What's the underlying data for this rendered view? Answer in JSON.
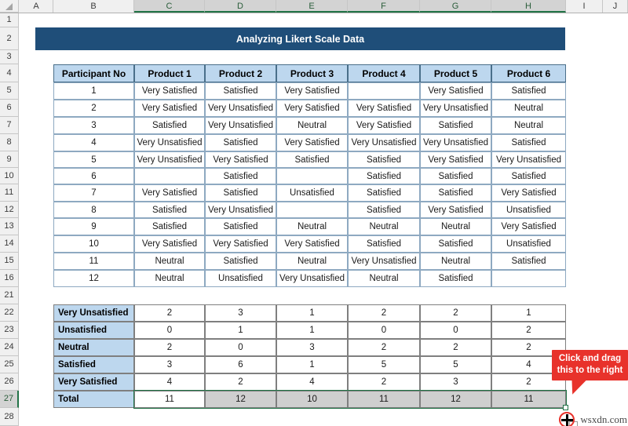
{
  "spreadsheet": {
    "column_headers": [
      "A",
      "B",
      "C",
      "D",
      "E",
      "F",
      "G",
      "H",
      "I",
      "J"
    ],
    "selected_columns": [
      "C",
      "D",
      "E",
      "F",
      "G",
      "H"
    ],
    "row_headers": [
      "1",
      "2",
      "3",
      "4",
      "5",
      "6",
      "7",
      "8",
      "9",
      "10",
      "11",
      "12",
      "13",
      "14",
      "15",
      "16",
      "21",
      "22",
      "23",
      "24",
      "25",
      "26",
      "27",
      "28"
    ],
    "selected_row": "27"
  },
  "title": {
    "text": "Analyzing Likert Scale Data",
    "background": "#1f4e79",
    "color": "#ffffff"
  },
  "main_table": {
    "headers": [
      "Participant No",
      "Product 1",
      "Product 2",
      "Product 3",
      "Product 4",
      "Product 5",
      "Product 6"
    ],
    "header_background": "#bdd7ee",
    "rows": [
      [
        "1",
        "Very Satisfied",
        "Satisfied",
        "Very Satisfied",
        "",
        "Very Satisfied",
        "Satisfied"
      ],
      [
        "2",
        "Very Satisfied",
        "Very Unsatisfied",
        "Very Satisfied",
        "Very Satisfied",
        "Very Unsatisfied",
        "Neutral"
      ],
      [
        "3",
        "Satisfied",
        "Very Unsatisfied",
        "Neutral",
        "Very Satisfied",
        "Satisfied",
        "Neutral"
      ],
      [
        "4",
        "Very Unsatisfied",
        "Satisfied",
        "Very Satisfied",
        "Very Unsatisfied",
        "Very Unsatisfied",
        "Satisfied"
      ],
      [
        "5",
        "Very Unsatisfied",
        "Very Satisfied",
        "Satisfied",
        "Satisfied",
        "Very Satisfied",
        "Very Unsatisfied"
      ],
      [
        "6",
        "",
        "Satisfied",
        "",
        "Satisfied",
        "Satisfied",
        "Satisfied"
      ],
      [
        "7",
        "Very Satisfied",
        "Satisfied",
        "Unsatisfied",
        "Satisfied",
        "Satisfied",
        "Very Satisfied"
      ],
      [
        "8",
        "Satisfied",
        "Very Unsatisfied",
        "",
        "Satisfied",
        "Very Satisfied",
        "Unsatisfied"
      ],
      [
        "9",
        "Satisfied",
        "Satisfied",
        "Neutral",
        "Neutral",
        "Neutral",
        "Very Satisfied"
      ],
      [
        "10",
        "Very Satisfied",
        "Very Satisfied",
        "Very Satisfied",
        "Satisfied",
        "Satisfied",
        "Unsatisfied"
      ],
      [
        "11",
        "Neutral",
        "Satisfied",
        "Neutral",
        "Very Unsatisfied",
        "Neutral",
        "Satisfied"
      ],
      [
        "12",
        "Neutral",
        "Unsatisfied",
        "Very Unsatisfied",
        "Neutral",
        "Satisfied",
        ""
      ]
    ]
  },
  "summary_table": {
    "labels": [
      "Very Unsatisfied",
      "Unsatisfied",
      "Neutral",
      "Satisfied",
      "Very Satisfied",
      "Total"
    ],
    "rows": [
      [
        "2",
        "3",
        "1",
        "2",
        "2",
        "1"
      ],
      [
        "0",
        "1",
        "1",
        "0",
        "0",
        "2"
      ],
      [
        "2",
        "0",
        "3",
        "2",
        "2",
        "2"
      ],
      [
        "3",
        "6",
        "1",
        "5",
        "5",
        "4"
      ],
      [
        "4",
        "2",
        "4",
        "2",
        "3",
        "2"
      ],
      [
        "11",
        "12",
        "10",
        "11",
        "12",
        "11"
      ]
    ],
    "total_row_index": 5,
    "active_cell_column_index": 0,
    "selection_color": "#217346",
    "selected_fill": "#cfcfcf"
  },
  "callout": {
    "text": "Click and drag this to the right",
    "background": "#e8322b",
    "color": "#ffffff"
  },
  "cursor": {
    "icon": "fill-handle-plus-cursor"
  },
  "watermark": {
    "text": "wsxdn.com"
  }
}
